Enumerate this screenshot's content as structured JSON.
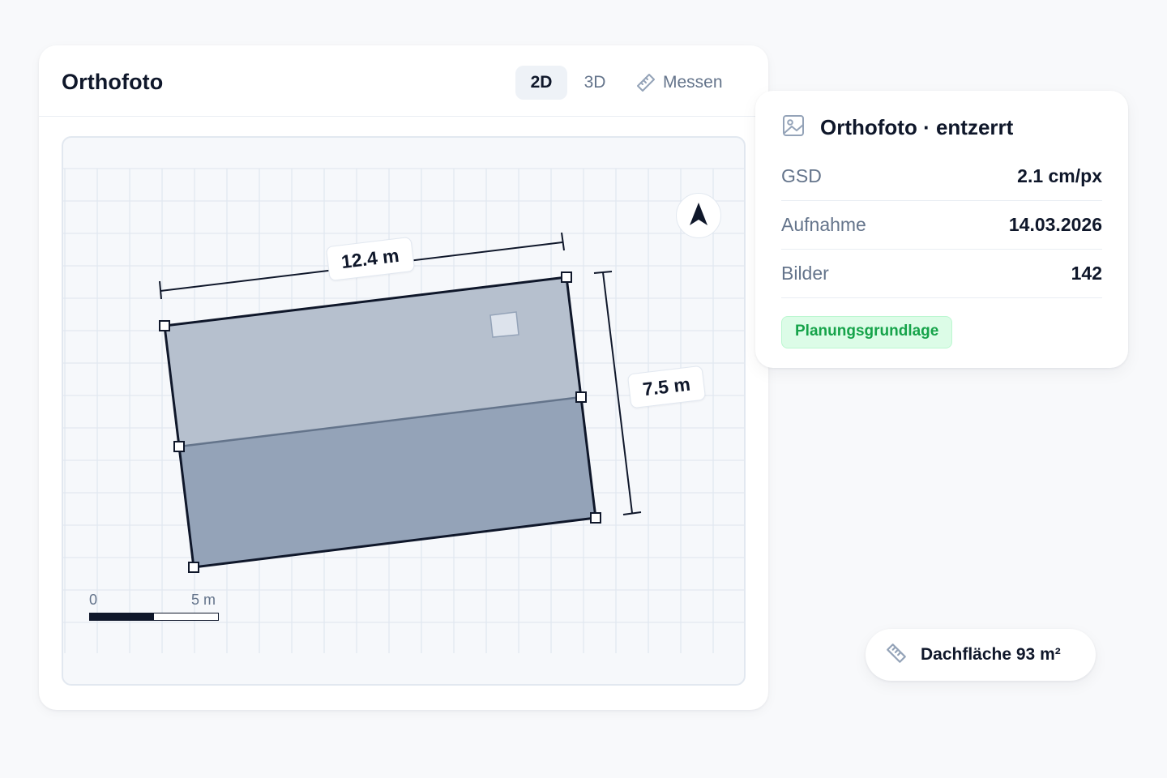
{
  "main": {
    "title": "Orthofoto",
    "view_toggle": {
      "options": [
        "2D",
        "3D"
      ],
      "selected": "2D"
    },
    "measure_label": "Messen",
    "measure_icon": "ruler-icon",
    "map": {
      "roof_width_label": "12.4 m",
      "roof_height_label": "7.5 m",
      "north_icon": "north-arrow-icon",
      "scale_start": "0",
      "scale_end": "5 m",
      "colors": {
        "roof_upper": "#b6c0ce",
        "roof_lower": "#94a3b8",
        "outline": "#0f172a",
        "grid": "#e2e8f0"
      }
    }
  },
  "info": {
    "icon": "image-icon",
    "title": "Orthofoto · entzerrt",
    "rows": [
      {
        "key": "GSD",
        "value": "2.1 cm/px"
      },
      {
        "key": "Aufnahme",
        "value": "14.03.2026"
      },
      {
        "key": "Bilder",
        "value": "142"
      }
    ],
    "badge": "Planungsgrundlage",
    "badge_color": "#16a34a"
  },
  "area_pill": {
    "icon": "ruler-icon",
    "label": "Dachfläche 93 m²"
  }
}
